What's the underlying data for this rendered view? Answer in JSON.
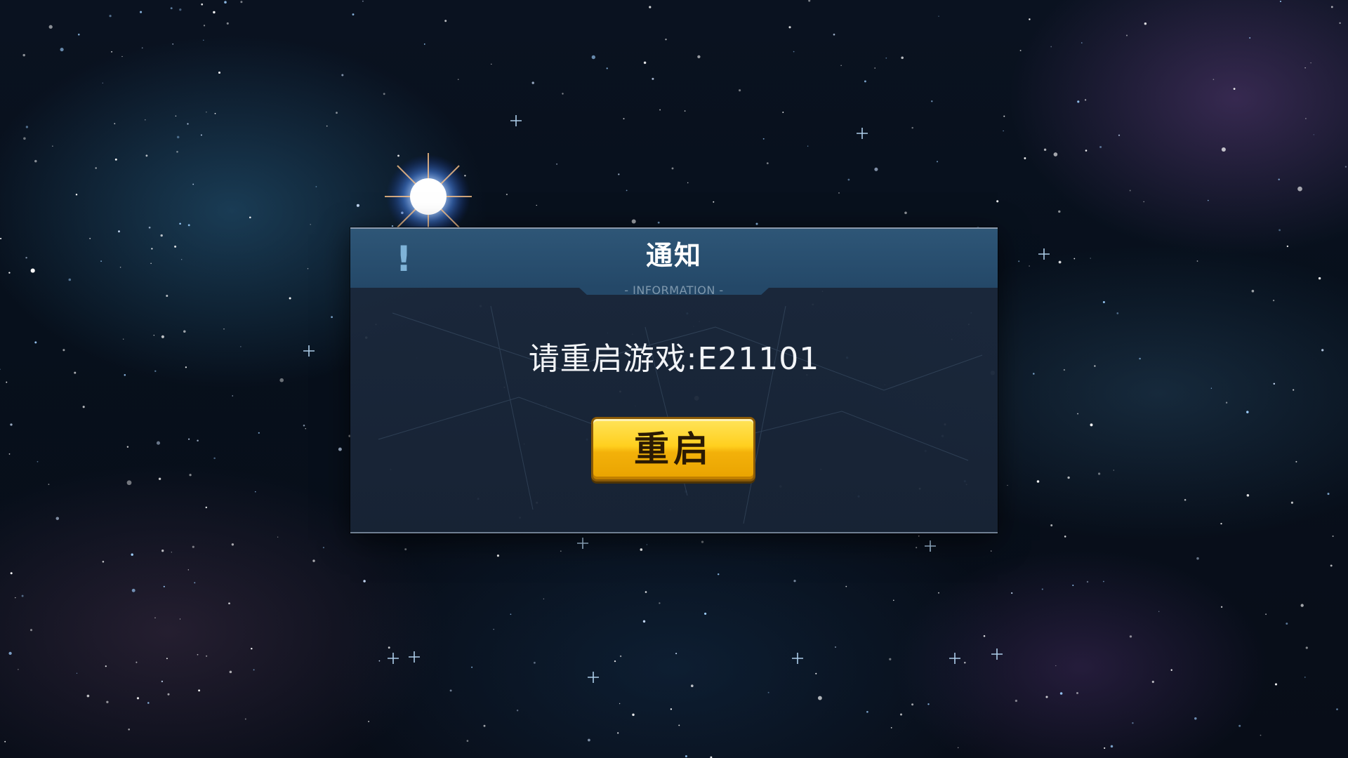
{
  "dialog": {
    "title": "通知",
    "subtitle": "- INFORMATION -",
    "alert_icon": "!",
    "message": "请重启游戏:E21101",
    "restart_label": "重启"
  },
  "colors": {
    "header": "#2e5677",
    "button": "#ffcf1e",
    "panel": "#1c2a3e"
  }
}
